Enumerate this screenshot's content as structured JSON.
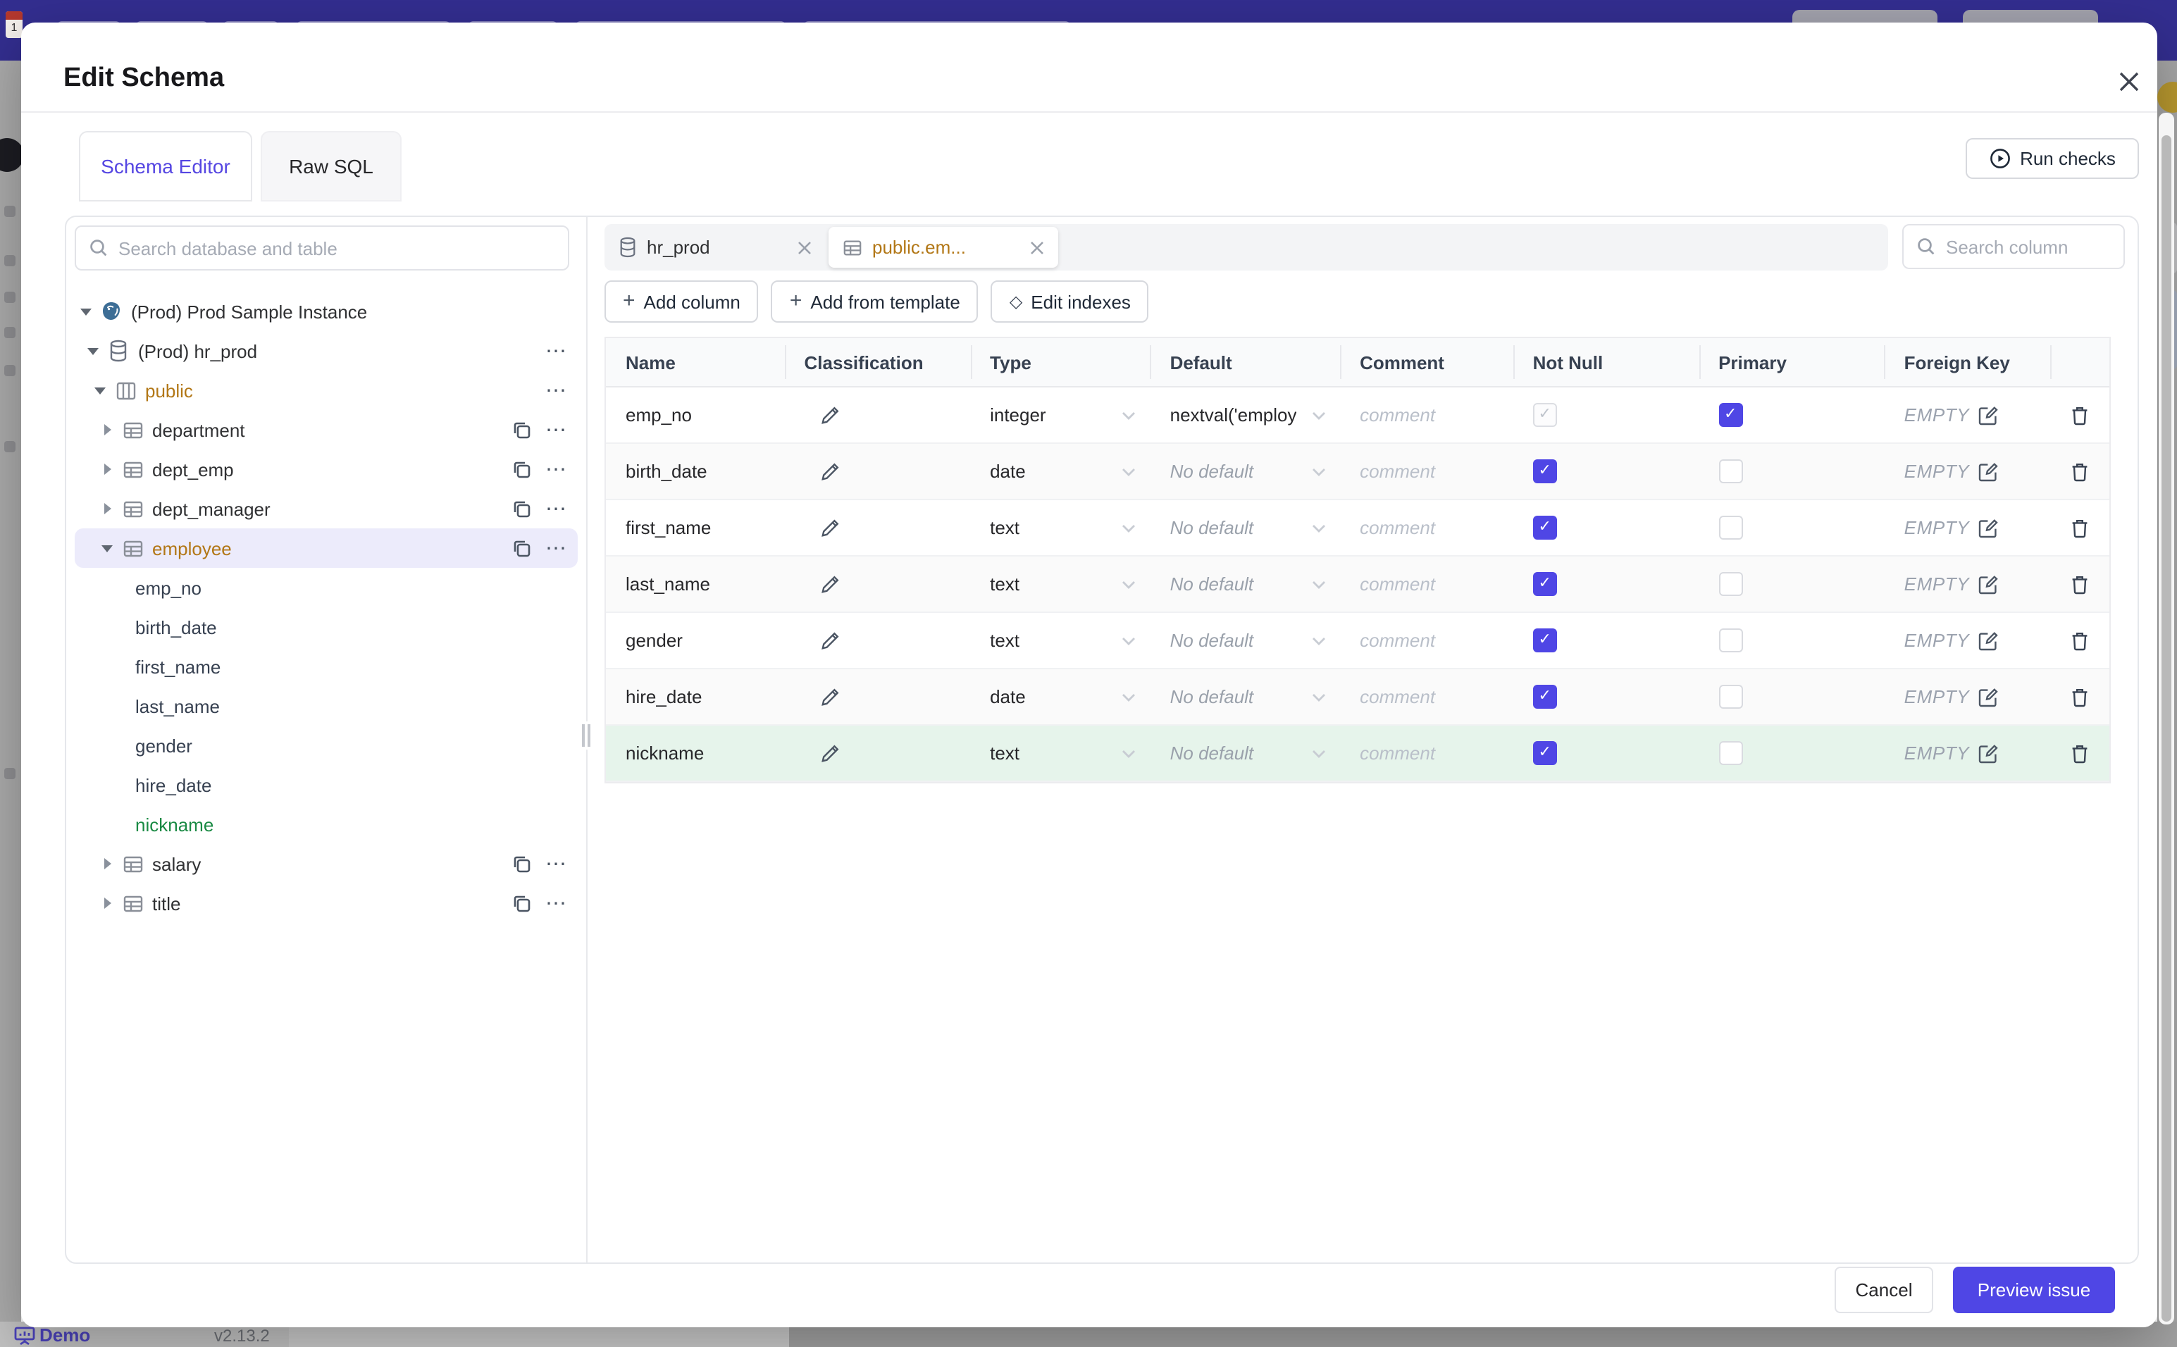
{
  "backdrop": {
    "banner_color": "#332e90",
    "calendar_day": "1",
    "status_bar": {
      "demo_label": "Demo",
      "version": "v2.13.2"
    }
  },
  "modal": {
    "title": "Edit Schema",
    "close_icon": "x-icon",
    "tabs": [
      {
        "label": "Schema Editor",
        "active": true
      },
      {
        "label": "Raw SQL",
        "active": false
      }
    ],
    "run_checks_label": "Run checks",
    "accent_color": "#4f46e5",
    "schema_accent_color": "#b27716",
    "changed_color": "#1a8a44",
    "sidebar": {
      "search_placeholder": "Search database and table",
      "tree": [
        {
          "label": "(Prod) Prod Sample Instance",
          "type": "instance",
          "expanded": true
        },
        {
          "label": "(Prod) hr_prod",
          "type": "database",
          "expanded": true
        },
        {
          "label": "public",
          "type": "schema",
          "expanded": true
        },
        {
          "label": "department",
          "type": "table",
          "expanded": false
        },
        {
          "label": "dept_emp",
          "type": "table",
          "expanded": false
        },
        {
          "label": "dept_manager",
          "type": "table",
          "expanded": false
        },
        {
          "label": "employee",
          "type": "table",
          "expanded": true,
          "selected": true
        },
        {
          "label": "emp_no",
          "type": "column"
        },
        {
          "label": "birth_date",
          "type": "column"
        },
        {
          "label": "first_name",
          "type": "column"
        },
        {
          "label": "last_name",
          "type": "column"
        },
        {
          "label": "gender",
          "type": "column"
        },
        {
          "label": "hire_date",
          "type": "column"
        },
        {
          "label": "nickname",
          "type": "column",
          "changed": true
        },
        {
          "label": "salary",
          "type": "table",
          "expanded": false
        },
        {
          "label": "title",
          "type": "table",
          "expanded": false
        }
      ]
    },
    "editor": {
      "chips": [
        {
          "label": "hr_prod",
          "icon": "database-icon",
          "active": false
        },
        {
          "label": "public.em...",
          "icon": "table-icon",
          "active": true
        }
      ],
      "column_search_placeholder": "Search column",
      "buttons": {
        "add_column": "Add column",
        "add_from_template": "Add from template",
        "edit_indexes": "Edit indexes"
      },
      "table": {
        "headers": [
          "Name",
          "Classification",
          "Type",
          "Default",
          "Comment",
          "Not Null",
          "Primary",
          "Foreign Key"
        ],
        "comment_placeholder": "comment",
        "no_default_text": "No default",
        "foreign_key_empty": "EMPTY",
        "rows": [
          {
            "name": "emp_no",
            "type": "integer",
            "default": "nextval('employ",
            "not_null": "checked-disabled",
            "primary": true,
            "foreign_key": "EMPTY"
          },
          {
            "name": "birth_date",
            "type": "date",
            "default": null,
            "not_null": "checked",
            "primary": false,
            "foreign_key": "EMPTY"
          },
          {
            "name": "first_name",
            "type": "text",
            "default": null,
            "not_null": "checked",
            "primary": false,
            "foreign_key": "EMPTY"
          },
          {
            "name": "last_name",
            "type": "text",
            "default": null,
            "not_null": "checked",
            "primary": false,
            "foreign_key": "EMPTY"
          },
          {
            "name": "gender",
            "type": "text",
            "default": null,
            "not_null": "checked",
            "primary": false,
            "foreign_key": "EMPTY"
          },
          {
            "name": "hire_date",
            "type": "date",
            "default": null,
            "not_null": "checked",
            "primary": false,
            "foreign_key": "EMPTY"
          },
          {
            "name": "nickname",
            "type": "text",
            "default": null,
            "not_null": "checked",
            "primary": false,
            "foreign_key": "EMPTY",
            "highlighted": true
          }
        ]
      }
    },
    "footer": {
      "cancel_label": "Cancel",
      "submit_label": "Preview issue"
    }
  }
}
